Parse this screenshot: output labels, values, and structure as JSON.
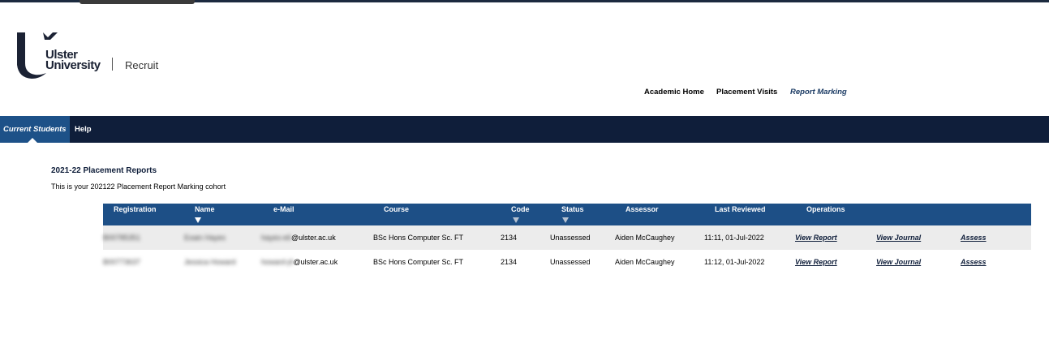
{
  "brand": {
    "name_line1": "Ulster",
    "name_line2": "University",
    "product": "Recruit"
  },
  "top_nav": [
    {
      "label": "Academic Home",
      "active": false
    },
    {
      "label": "Placement Visits",
      "active": false
    },
    {
      "label": "Report Marking",
      "active": true
    }
  ],
  "main_nav": [
    {
      "label": "Current Students",
      "active": true
    },
    {
      "label": "Help",
      "active": false
    }
  ],
  "section": {
    "title": "2021-22 Placement Reports",
    "description": "This is your 202122 Placement Report Marking cohort"
  },
  "table": {
    "columns": [
      "Registration",
      "Name",
      "e-Mail",
      "Course",
      "Code",
      "Status",
      "Assessor",
      "Last Reviewed",
      "Operations"
    ],
    "rows": [
      {
        "registration": "B00785351",
        "name": "Eoain Hayes",
        "email_prefix": "hayes-e6",
        "email_domain": "@ulster.ac.uk",
        "course": "BSc Hons Computer Sc. FT",
        "code": "2134",
        "status": "Unassessed",
        "assessor": "Aiden McCaughey",
        "last_reviewed": "11:11, 01-Jul-2022",
        "op_view_report": "View Report",
        "op_view_journal": "View Journal",
        "op_assess": "Assess"
      },
      {
        "registration": "B00773637",
        "name": "Jessica Howard",
        "email_prefix": "howard-j4",
        "email_domain": "@ulster.ac.uk",
        "course": "BSc Hons Computer Sc. FT",
        "code": "2134",
        "status": "Unassessed",
        "assessor": "Aiden McCaughey",
        "last_reviewed": "11:12, 01-Jul-2022",
        "op_view_report": "View Report",
        "op_view_journal": "View Journal",
        "op_assess": "Assess"
      }
    ]
  },
  "colors": {
    "nav_dark": "#0f1e3a",
    "nav_active": "#1d5188",
    "table_header": "#1d4f86",
    "row_alt": "#ececec"
  }
}
